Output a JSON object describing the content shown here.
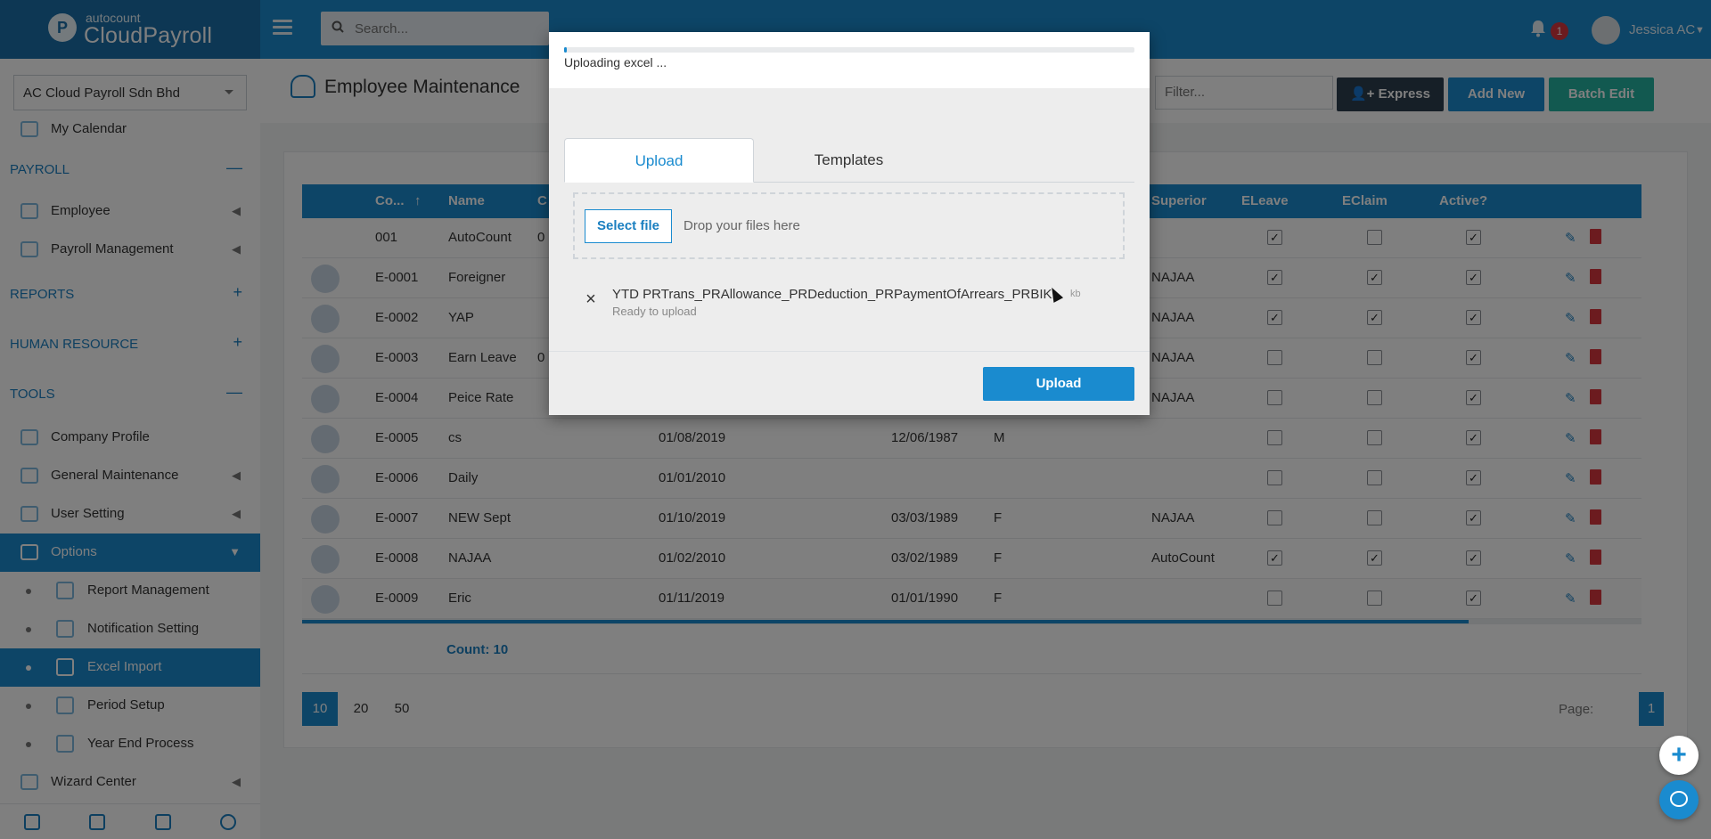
{
  "topbar": {
    "logo_small": "autocount",
    "logo_big": "CloudPayroll",
    "search_placeholder": "Search...",
    "notification_count": "1",
    "user_name": "Jessica AC"
  },
  "sidebar": {
    "company": "AC Cloud Payroll Sdn Bhd",
    "my_calendar": "My Calendar",
    "sections": {
      "payroll": "PAYROLL",
      "reports": "REPORTS",
      "human_resource": "HUMAN RESOURCE",
      "tools": "TOOLS"
    },
    "payroll_items": [
      "Employee",
      "Payroll Management"
    ],
    "tools_items": [
      "Company Profile",
      "General Maintenance",
      "User Setting",
      "Options"
    ],
    "options_items": [
      "Report Management",
      "Notification Setting",
      "Excel Import",
      "Period Setup",
      "Year End Process"
    ],
    "wizard_center": "Wizard Center"
  },
  "page": {
    "title": "Employee Maintenance",
    "filter_placeholder": "Filter...",
    "express_label": "Express",
    "add_new_label": "Add New",
    "batch_edit_label": "Batch Edit"
  },
  "grid": {
    "headers": [
      "Co...",
      "Name",
      "C",
      "Superior",
      "ELeave",
      "EClaim",
      "Active?"
    ],
    "rows": [
      {
        "code": "001",
        "name": "AutoCount",
        "col3": "0",
        "join": "",
        "dob": "",
        "gender": "",
        "superior": "",
        "eleave": true,
        "eclaim": false,
        "active": true
      },
      {
        "code": "E-0001",
        "name": "Foreigner",
        "col3": "",
        "join": "",
        "dob": "",
        "gender": "",
        "superior": "NAJAA",
        "eleave": true,
        "eclaim": true,
        "active": true
      },
      {
        "code": "E-0002",
        "name": "YAP",
        "col3": "",
        "join": "",
        "dob": "",
        "gender": "",
        "superior": "NAJAA",
        "eleave": true,
        "eclaim": true,
        "active": true
      },
      {
        "code": "E-0003",
        "name": "Earn Leave",
        "col3": "0",
        "join": "",
        "dob": "",
        "gender": "",
        "superior": "NAJAA",
        "eleave": false,
        "eclaim": false,
        "active": true
      },
      {
        "code": "E-0004",
        "name": "Peice Rate",
        "col3": "",
        "join": "",
        "dob": "",
        "gender": "",
        "superior": "NAJAA",
        "eleave": false,
        "eclaim": false,
        "active": true
      },
      {
        "code": "E-0005",
        "name": "cs",
        "col3": "",
        "join": "01/08/2019",
        "dob": "12/06/1987",
        "gender": "M",
        "superior": "",
        "eleave": false,
        "eclaim": false,
        "active": true
      },
      {
        "code": "E-0006",
        "name": "Daily",
        "col3": "",
        "join": "01/01/2010",
        "dob": "",
        "gender": "",
        "superior": "",
        "eleave": false,
        "eclaim": false,
        "active": true
      },
      {
        "code": "E-0007",
        "name": "NEW Sept",
        "col3": "",
        "join": "01/10/2019",
        "dob": "03/03/1989",
        "gender": "F",
        "superior": "NAJAA",
        "eleave": false,
        "eclaim": false,
        "active": true
      },
      {
        "code": "E-0008",
        "name": "NAJAA",
        "col3": "",
        "join": "01/02/2010",
        "dob": "03/02/1989",
        "gender": "F",
        "superior": "AutoCount",
        "eleave": true,
        "eclaim": true,
        "active": true
      },
      {
        "code": "E-0009",
        "name": "Eric",
        "col3": "",
        "join": "01/11/2019",
        "dob": "01/01/1990",
        "gender": "F",
        "superior": "",
        "eleave": false,
        "eclaim": false,
        "active": true
      }
    ],
    "count_label": "Count: 10"
  },
  "pager": {
    "sizes": [
      "10",
      "20",
      "50"
    ],
    "page_label": "Page:",
    "page_num": "1"
  },
  "dialog": {
    "progress_text": "Uploading excel ...",
    "progress_fraction": 0.004,
    "tab_upload": "Upload",
    "tab_templates": "Templates",
    "select_file": "Select file",
    "drop_text": "Drop your files here",
    "file_name": "YTD PRTrans_PRAllowance_PRDeduction_PRPaymentOfArrears_PRBIK...",
    "file_size": "kb",
    "file_status": "Ready to upload",
    "upload_button": "Upload"
  }
}
